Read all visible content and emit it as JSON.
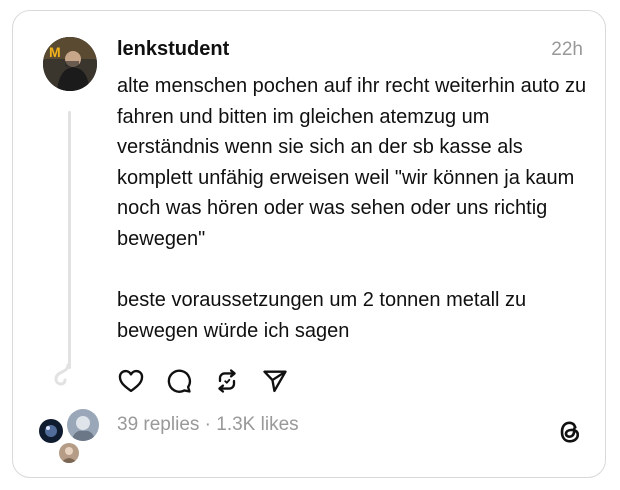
{
  "post": {
    "username": "lenkstudent",
    "time": "22h",
    "paragraph_1": "alte menschen pochen auf ihr recht weiterhin auto zu fahren und bitten im gleichen atemzug um verständnis wenn sie sich an der sb kasse als komplett unfähig erweisen weil \"wir können ja kaum noch was hören oder was sehen oder uns richtig bewegen\"",
    "paragraph_2": "beste voraussetzungen um 2 tonnen metall zu bewegen würde ich sagen",
    "stats": "39 replies · 1.3K likes"
  },
  "icons": {
    "like": "heart-icon",
    "reply": "comment-icon",
    "repost": "repost-icon",
    "share": "send-icon",
    "brand": "threads-logo-icon"
  },
  "colors": {
    "text": "#101010",
    "muted": "#999999",
    "border": "#d9d9d9",
    "thread_line": "#e2e2e2"
  }
}
